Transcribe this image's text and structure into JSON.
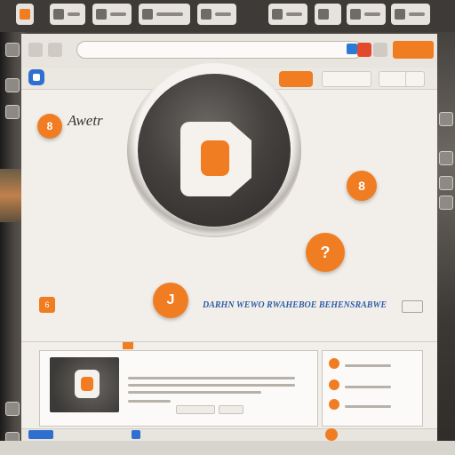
{
  "colors": {
    "accent": "#f07d22",
    "link": "#2f5ea8",
    "brand": "#2f6fcf"
  },
  "browser": {
    "signin_label": ""
  },
  "site": {
    "title": "",
    "nav_primary": "",
    "nav_links": [
      "",
      "",
      ""
    ]
  },
  "feature": {
    "badge": "8",
    "title": "Awetr",
    "subtitle": "",
    "description": ""
  },
  "bubbles": {
    "a": "8",
    "b": "?",
    "c": "J"
  },
  "banner": {
    "icon": "6",
    "label": "",
    "heading": "DARHN WEWO RWAHEBOE BEHENSRABWE",
    "chip": ""
  },
  "section": {
    "label": ""
  },
  "card": {
    "title": "",
    "tag": ""
  },
  "side_items": [
    "",
    "",
    ""
  ],
  "footer": {
    "button": "",
    "left_text": "",
    "right_text": ""
  },
  "icons": [
    "search-icon",
    "shield-icon",
    "help-icon",
    "menu-icon"
  ]
}
